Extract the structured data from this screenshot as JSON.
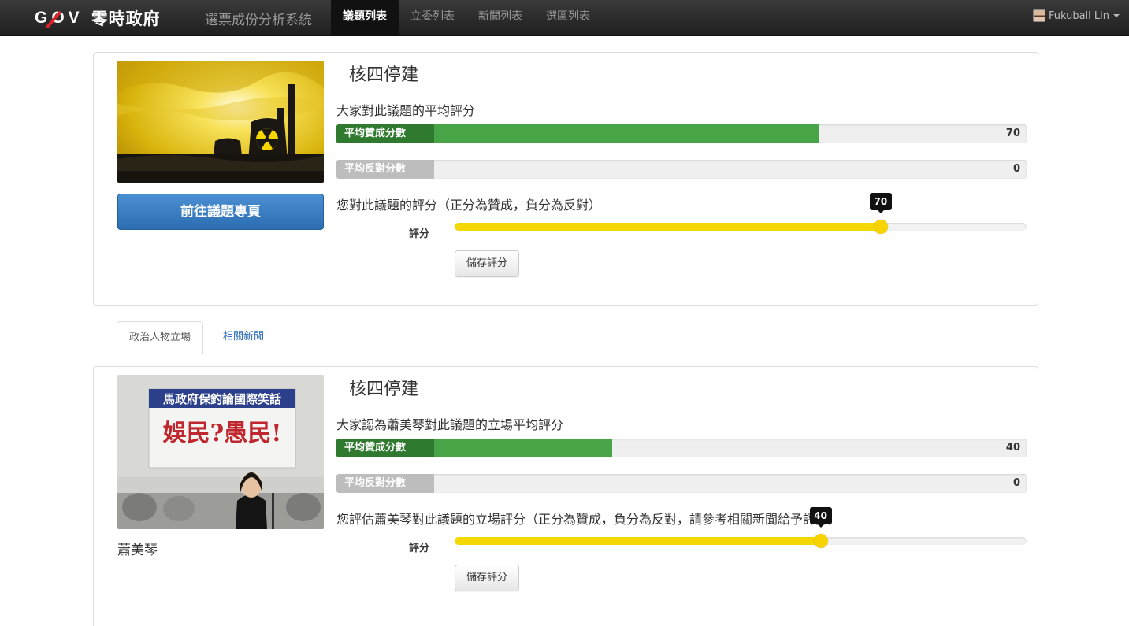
{
  "nav": {
    "brand_logo": "GOV",
    "brand_name": "零時政府",
    "app_title": "選票成份分析系統",
    "items": [
      {
        "label": "議題列表",
        "active": true
      },
      {
        "label": "立委列表",
        "active": false
      },
      {
        "label": "新聞列表",
        "active": false
      },
      {
        "label": "選區列表",
        "active": false
      }
    ],
    "user_name": "Fukuball Lin"
  },
  "issue": {
    "title": "核四停建",
    "avg_heading": "大家對此議題的平均評分",
    "pro_label": "平均贊成分數",
    "pro_value": 70,
    "pro_value_text": "70",
    "con_label": "平均反對分數",
    "con_value": 0,
    "con_value_text": "0",
    "question": "您對此議題的評分（正分為贊成，負分為反對）",
    "slider_label": "評分",
    "slider_value": 70,
    "slider_value_text": "70",
    "save_label": "儲存評分",
    "goto_label": "前往議題專頁"
  },
  "tabs": [
    {
      "label": "政治人物立場",
      "active": true
    },
    {
      "label": "相關新聞",
      "active": false
    }
  ],
  "stance": {
    "title": "核四停建",
    "person_name": "蕭美琴",
    "banner_text": "馬政府保釣論國際笑話",
    "banner_slogan": "娛民?愚民!",
    "avg_heading": "大家認為蕭美琴對此議題的立場平均評分",
    "pro_label": "平均贊成分數",
    "pro_value": 40,
    "pro_value_text": "40",
    "con_label": "平均反對分數",
    "con_value": 0,
    "con_value_text": "0",
    "question": "您評估蕭美琴對此議題的立場評分（正分為贊成，負分為反對，請參考相關新聞給予評分）",
    "slider_label": "評分",
    "slider_value": 40,
    "slider_value_text": "40",
    "save_label": "儲存評分"
  },
  "colors": {
    "navbar": "#222222",
    "pro_bar": "#47a547",
    "slider": "#f5d800",
    "primary_button": "#2c6db1",
    "link": "#2a6ab8"
  }
}
